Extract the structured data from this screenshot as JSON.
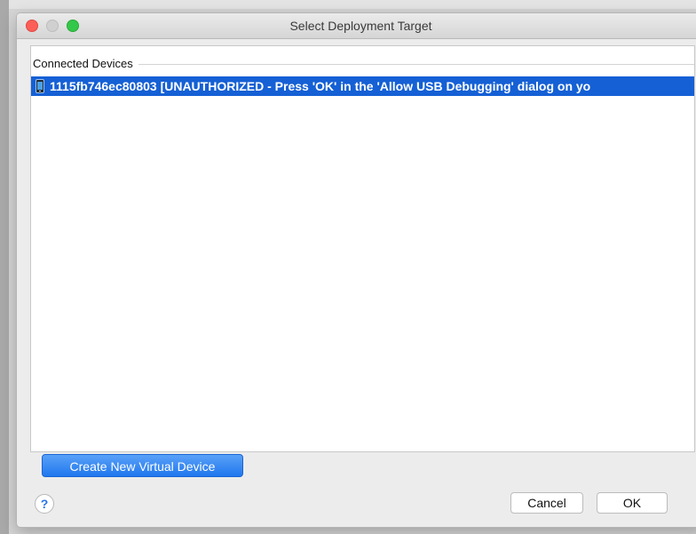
{
  "window": {
    "title": "Select Deployment Target"
  },
  "devices": {
    "group_label": "Connected Devices",
    "items": [
      {
        "label": "1115fb746ec80803 [UNAUTHORIZED - Press 'OK' in the 'Allow USB Debugging' dialog on yo",
        "icon": "phone-icon",
        "selected": true
      }
    ]
  },
  "actions": {
    "create_virtual_device_label": "Create New Virtual Device",
    "help_label": "?",
    "cancel_label": "Cancel",
    "ok_label": "OK"
  },
  "colors": {
    "selection": "#1560d5",
    "primary_button": "#1f77ee",
    "close": "#fc5f57",
    "zoom": "#34c84a"
  }
}
